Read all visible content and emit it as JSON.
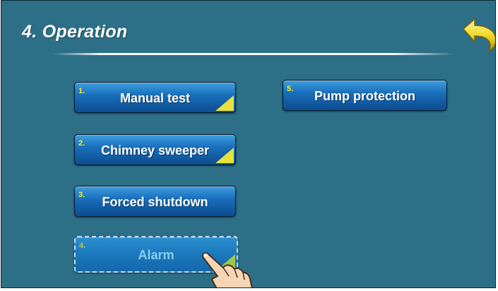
{
  "header": {
    "title": "4. Operation"
  },
  "back_button": {
    "icon": "back-arrow-icon",
    "color": "#f4df2e"
  },
  "menu": {
    "items": [
      {
        "number": "1.",
        "label": "Manual test",
        "corner": true,
        "disabled": false
      },
      {
        "number": "2.",
        "label": "Chimney sweeper",
        "corner": true,
        "disabled": false
      },
      {
        "number": "3.",
        "label": "Forced shutdown",
        "corner": false,
        "disabled": false
      },
      {
        "number": "4.",
        "label": "Alarm",
        "corner": true,
        "disabled": true
      },
      {
        "number": "5.",
        "label": "Pump protection",
        "corner": false,
        "disabled": false
      }
    ]
  },
  "colors": {
    "background": "#2d6f86",
    "button": "#1a70bd",
    "number": "#f7f21f",
    "corner": "#e7e23a"
  }
}
